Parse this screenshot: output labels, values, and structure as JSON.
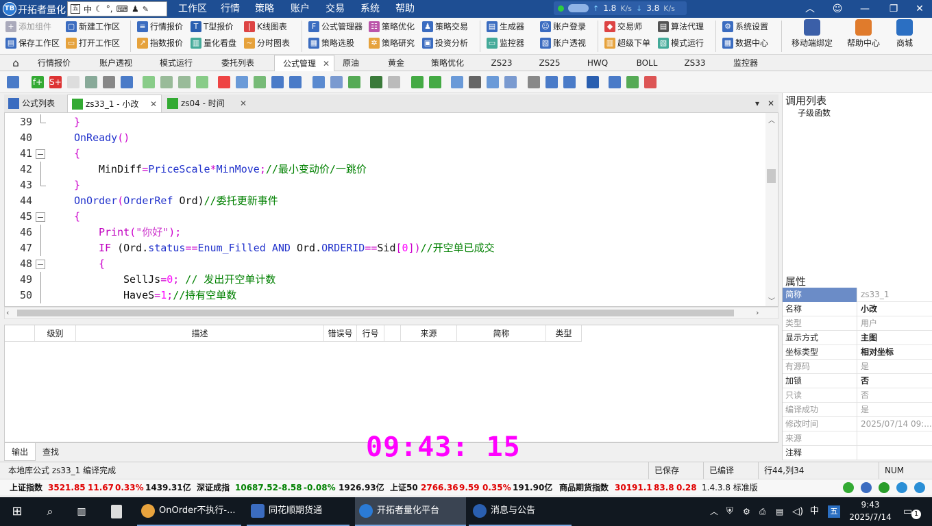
{
  "window": {
    "app_title": "开拓者量化",
    "ime": {
      "lang": "中",
      "moon": "☾",
      "dots": "°,",
      "keyboard": "⌨",
      "user": "♟",
      "wrench": "🔧"
    },
    "menu": [
      "工作区",
      "行情",
      "策略",
      "账户",
      "交易",
      "系统",
      "帮助"
    ],
    "net": {
      "up": "1.8",
      "up_unit": "K/s",
      "down": "3.8",
      "down_unit": "K/s"
    }
  },
  "ribbon": {
    "row1": [
      {
        "label": "添加组件",
        "disabled": true
      },
      {
        "label": "新建工作区"
      },
      {
        "label": "行情报价"
      },
      {
        "label": "T型报价"
      },
      {
        "label": "K线图表"
      },
      {
        "label": "公式管理器"
      },
      {
        "label": "策略优化"
      },
      {
        "label": "策略交易"
      },
      {
        "label": "生成器"
      },
      {
        "label": "账户登录"
      },
      {
        "label": "交易师"
      },
      {
        "label": "算法代理"
      },
      {
        "label": "系统设置"
      }
    ],
    "row2": [
      {
        "label": "保存工作区"
      },
      {
        "label": "打开工作区"
      },
      {
        "label": "指数报价"
      },
      {
        "label": "量化看盘"
      },
      {
        "label": "分时图表"
      },
      {
        "label": "策略选股"
      },
      {
        "label": "策略研究"
      },
      {
        "label": "投资分析"
      },
      {
        "label": "监控器"
      },
      {
        "label": "账户透视"
      },
      {
        "label": "超级下单"
      },
      {
        "label": "模式运行"
      },
      {
        "label": "数据中心"
      }
    ],
    "big": [
      {
        "label": "移动端绑定"
      },
      {
        "label": "帮助中心"
      },
      {
        "label": "商城"
      }
    ]
  },
  "workspace_tabs": [
    "行情报价",
    "账户透视",
    "模式运行",
    "委托列表",
    "公式管理",
    "原油",
    "黄金",
    "策略优化",
    "ZS23",
    "ZS25",
    "HWQ",
    "BOLL",
    "ZS33",
    "监控器"
  ],
  "editor_tabs": [
    {
      "label": "公式列表"
    },
    {
      "label": "zs33_1 - 小改"
    },
    {
      "label": "zs04 - 时间"
    }
  ],
  "code": {
    "l39": {
      "num": "39",
      "t1": "}"
    },
    "l40": {
      "num": "40",
      "t1": "OnReady",
      "t2": "()"
    },
    "l41": {
      "num": "41",
      "t1": "{"
    },
    "l42": {
      "num": "42",
      "a": "MinDiff",
      "b": "=",
      "c": "PriceScale",
      "d": "*",
      "e": "MinMove",
      "f": ";",
      "g": "//最小变动价/一跳价"
    },
    "l43": {
      "num": "43",
      "t1": "}"
    },
    "l44": {
      "num": "44",
      "a": "OnOrder",
      "b": "(",
      "c": "OrderRef",
      "d": " Ord)",
      "e": "//委托更新事件"
    },
    "l45": {
      "num": "45",
      "t1": "{"
    },
    "l46": {
      "num": "46",
      "a": "Print",
      "b": "(",
      "c": "\"你好\"",
      "d": ");"
    },
    "l47": {
      "num": "47",
      "a": "IF",
      "b": " (Ord.",
      "c": "status",
      "d": "==",
      "e": "Enum_Filled",
      "f": " AND ",
      "g": "Ord.",
      "h": "ORDERID",
      "i": "==",
      "j": "Sid",
      "k": "[",
      "l": "0",
      "m": "])",
      "n": "//开空单已成交"
    },
    "l48": {
      "num": "48",
      "t1": "{"
    },
    "l49": {
      "num": "49",
      "a": "SellJs",
      "b": "=",
      "c": "0",
      "d": ";",
      "e": " // 发出开空单计数"
    },
    "l50": {
      "num": "50",
      "a": "HaveS",
      "b": "=",
      "c": "1",
      "d": ";",
      "e": "//持有空单数"
    }
  },
  "error_table": {
    "headers": [
      "级别",
      "描述",
      "错误号",
      "行号",
      "来源",
      "简称",
      "类型"
    ]
  },
  "output_tabs": [
    "输出",
    "查找"
  ],
  "clock": "09:43: 15",
  "status": {
    "message": "本地库公式 zs33_1 编译完成",
    "saved": "已保存",
    "compiled": "已编译",
    "position": "行44,列34",
    "num": "NUM"
  },
  "indices": [
    {
      "name": "上证指数",
      "price": "3521.85",
      "chg": "11.67",
      "pct": "0.33%",
      "amt": "1439.31亿",
      "up": true
    },
    {
      "name": "深证成指",
      "price": "10687.52",
      "chg": "-8.58",
      "pct": "-0.08%",
      "amt": "1926.93亿",
      "up": false
    },
    {
      "name": "上证50",
      "price": "2766.36",
      "chg": "9.59",
      "pct": "0.35%",
      "amt": "191.90亿",
      "up": true
    },
    {
      "name": "商品期货指数",
      "price": "30191.1",
      "chg": "83.8",
      "pct": "0.28%",
      "amt": "",
      "up": true
    }
  ],
  "version": "1.4.3.8 标准版",
  "right_panel": {
    "call_list_title": "调用列表",
    "call_list_item": "子级函数",
    "props_title": "属性",
    "props": [
      {
        "k": "简称",
        "v": "zs33_1",
        "state": "sel"
      },
      {
        "k": "名称",
        "v": "小改",
        "state": "bold"
      },
      {
        "k": "类型",
        "v": "用户",
        "state": "gray"
      },
      {
        "k": "显示方式",
        "v": "主图",
        "state": "bold"
      },
      {
        "k": "坐标类型",
        "v": "相对坐标",
        "state": "bold"
      },
      {
        "k": "有源码",
        "v": "是",
        "state": "gray"
      },
      {
        "k": "加锁",
        "v": "否",
        "state": "bold"
      },
      {
        "k": "只读",
        "v": "否",
        "state": "gray"
      },
      {
        "k": "编译成功",
        "v": "是",
        "state": "gray"
      },
      {
        "k": "修改时间",
        "v": "2025/07/14 09:...",
        "state": "gray"
      },
      {
        "k": "来源",
        "v": "",
        "state": "gray"
      },
      {
        "k": "注释",
        "v": "",
        "state": "normal"
      }
    ]
  },
  "taskbar": {
    "items": [
      {
        "label": "OnOrder不执行-..."
      },
      {
        "label": "同花顺期货通"
      },
      {
        "label": "开拓者量化平台"
      },
      {
        "label": "消息与公告"
      }
    ],
    "ime": "中",
    "ime2": "五",
    "time": "9:43",
    "date": "2025/7/14",
    "notify": "1"
  }
}
